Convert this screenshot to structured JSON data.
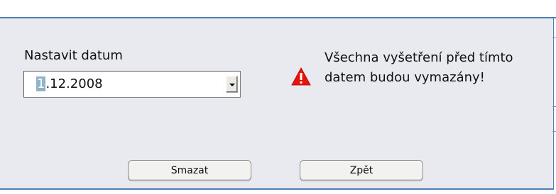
{
  "form": {
    "date_label": "Nastavit datum",
    "date_value_selected": "1",
    "date_value_rest": ".12.2008"
  },
  "warning": {
    "icon": "warning-triangle-icon",
    "icon_color": "#e8140c",
    "line1": "Všechna vyšetření před tímto",
    "line2": "datem budou vymazány!"
  },
  "buttons": {
    "delete_label": "Smazat",
    "back_label": "Zpět"
  },
  "colors": {
    "border_accent": "#4a7fb8",
    "dialog_background": "#e8eaf0",
    "selection": "#8fb3c9"
  }
}
